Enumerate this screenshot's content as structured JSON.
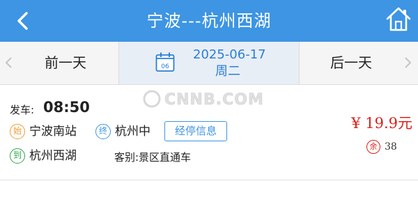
{
  "header": {
    "title": "宁波---杭州西湖",
    "back_icon": "chevron-left-icon",
    "home_icon": "home-icon",
    "background_color": "#3d95e3"
  },
  "date_bar": {
    "prev_label": "前一天",
    "next_label": "后一天",
    "date": "2025-06-17",
    "weekday": "周二",
    "calendar_day": "06",
    "calendar_icon": "calendar-icon",
    "accent_color": "#2a7fd6"
  },
  "watermark": {
    "text": "CNNB.COM"
  },
  "ticket": {
    "depart_label": "发车:",
    "depart_time": "08:50",
    "start_badge": "始",
    "start_station": "宁波南站",
    "end_badge": "终",
    "end_station": "杭州中",
    "stops_button": "经停信息",
    "arrive_badge": "到",
    "arrive_station": "杭州西湖",
    "bus_type": "客别:景区直通车",
    "price": "¥ 19.9元",
    "seat_badge": "余",
    "seats_left": "38",
    "price_color": "#d9221c"
  }
}
